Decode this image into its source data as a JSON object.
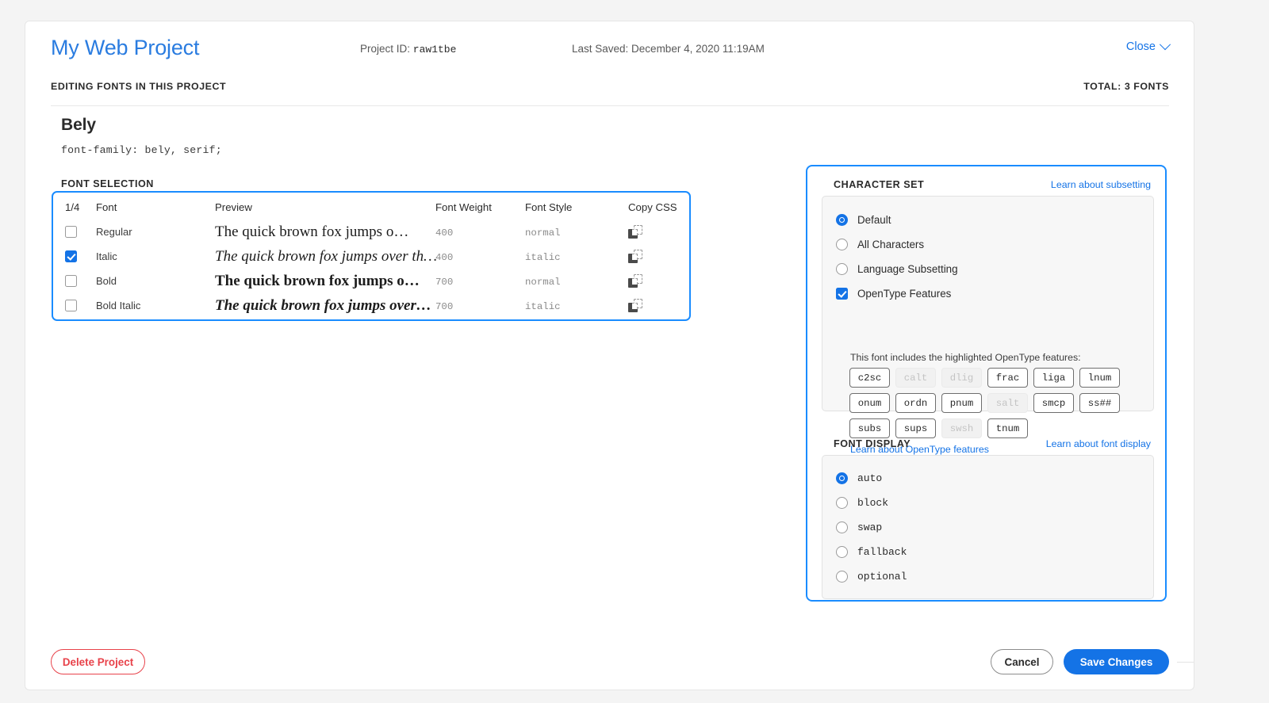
{
  "header": {
    "project_title": "My Web Project",
    "project_id_label": "Project ID:",
    "project_id_value": "raw1tbe",
    "last_saved": "Last Saved: December 4, 2020 11:19AM",
    "close_label": "Close",
    "editing_label": "EDITING FONTS IN THIS PROJECT",
    "total_label": "TOTAL: 3 FONTS"
  },
  "family": {
    "name": "Bely",
    "css_declaration": "font-family: bely, serif;",
    "section_label": "FONT SELECTION"
  },
  "font_table": {
    "columns": {
      "count": "1/4",
      "font": "Font",
      "preview": "Preview",
      "weight": "Font Weight",
      "style": "Font Style",
      "copy": "Copy CSS"
    },
    "rows": [
      {
        "checked": false,
        "font": "Regular",
        "preview": "The quick brown fox jumps o…",
        "preview_style": "normal",
        "weight": "400",
        "style": "normal"
      },
      {
        "checked": true,
        "font": "Italic",
        "preview": "The quick brown fox jumps over th…",
        "preview_style": "italic",
        "weight": "400",
        "style": "italic"
      },
      {
        "checked": false,
        "font": "Bold",
        "preview": "The quick brown fox jumps o…",
        "preview_style": "bold",
        "weight": "700",
        "style": "normal"
      },
      {
        "checked": false,
        "font": "Bold Italic",
        "preview": "The quick brown fox jumps over…",
        "preview_style": "bold-italic",
        "weight": "700",
        "style": "italic"
      }
    ]
  },
  "character_set": {
    "title": "CHARACTER SET",
    "link": "Learn about subsetting",
    "options": [
      {
        "label": "Default",
        "type": "radio",
        "selected": true
      },
      {
        "label": "All Characters",
        "type": "radio",
        "selected": false
      },
      {
        "label": "Language Subsetting",
        "type": "radio",
        "selected": false
      },
      {
        "label": "OpenType Features",
        "type": "checkbox",
        "selected": true
      }
    ],
    "opentype_note": "This font includes the highlighted OpenType features:",
    "opentype_tags": [
      {
        "tag": "c2sc",
        "enabled": true
      },
      {
        "tag": "calt",
        "enabled": false
      },
      {
        "tag": "dlig",
        "enabled": false
      },
      {
        "tag": "frac",
        "enabled": true
      },
      {
        "tag": "liga",
        "enabled": true
      },
      {
        "tag": "lnum",
        "enabled": true
      },
      {
        "tag": "onum",
        "enabled": true
      },
      {
        "tag": "ordn",
        "enabled": true
      },
      {
        "tag": "pnum",
        "enabled": true
      },
      {
        "tag": "salt",
        "enabled": false
      },
      {
        "tag": "smcp",
        "enabled": true
      },
      {
        "tag": "ss##",
        "enabled": true
      },
      {
        "tag": "subs",
        "enabled": true
      },
      {
        "tag": "sups",
        "enabled": true
      },
      {
        "tag": "swsh",
        "enabled": false
      },
      {
        "tag": "tnum",
        "enabled": true
      }
    ],
    "opentype_link": "Learn about OpenType features"
  },
  "font_display": {
    "title": "FONT DISPLAY",
    "link": "Learn about font display",
    "options": [
      {
        "label": "auto",
        "selected": true
      },
      {
        "label": "block",
        "selected": false
      },
      {
        "label": "swap",
        "selected": false
      },
      {
        "label": "fallback",
        "selected": false
      },
      {
        "label": "optional",
        "selected": false
      }
    ]
  },
  "footer": {
    "delete_label": "Delete Project",
    "cancel_label": "Cancel",
    "save_label": "Save Changes"
  },
  "colors": {
    "accent_blue": "#1473e6",
    "highlight_blue": "#1a8cff",
    "danger_red": "#e8424a"
  }
}
